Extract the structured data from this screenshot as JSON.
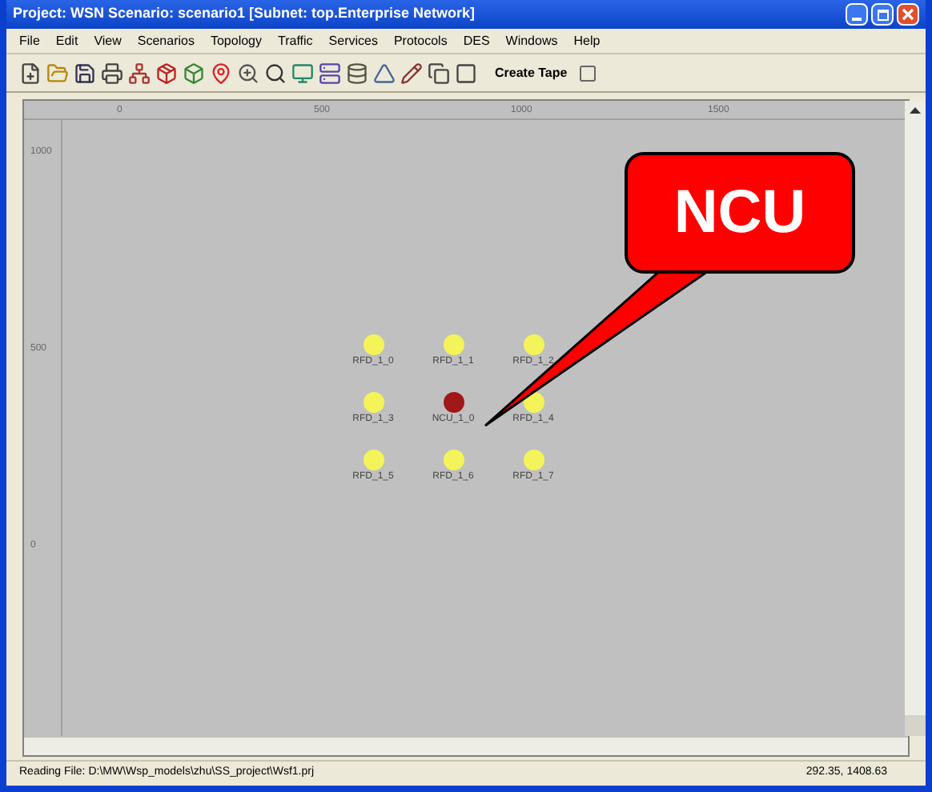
{
  "window": {
    "title": "Project: WSN Scenario: scenario1 [Subnet: top.Enterprise Network]"
  },
  "menus": [
    "File",
    "Edit",
    "View",
    "Scenarios",
    "Topology",
    "Traffic",
    "Services",
    "Protocols",
    "DES",
    "Windows",
    "Help"
  ],
  "toolbar": {
    "create_tape": "Create Tape"
  },
  "rulers": {
    "x_ticks": [
      "0",
      "500",
      "1000",
      "1500"
    ],
    "y_ticks": [
      "1000",
      "500",
      "0"
    ]
  },
  "nodes": [
    {
      "label": "RFD_1_0",
      "color": "#f4f45a"
    },
    {
      "label": "RFD_1_1",
      "color": "#f4f45a"
    },
    {
      "label": "RFD_1_2",
      "color": "#f4f45a"
    },
    {
      "label": "RFD_1_3",
      "color": "#f4f45a"
    },
    {
      "label": "NCU_1_0",
      "color": "#a01818"
    },
    {
      "label": "RFD_1_4",
      "color": "#f4f45a"
    },
    {
      "label": "RFD_1_5",
      "color": "#f4f45a"
    },
    {
      "label": "RFD_1_6",
      "color": "#f4f45a"
    },
    {
      "label": "RFD_1_7",
      "color": "#f4f45a"
    }
  ],
  "callout": {
    "text": "NCU"
  },
  "status_bar": {
    "message": "Reading File: D:\\MW\\Wsp_models\\zhu\\SS_project\\Wsf1.prj",
    "coordinates": "292.35, 1408.63"
  }
}
